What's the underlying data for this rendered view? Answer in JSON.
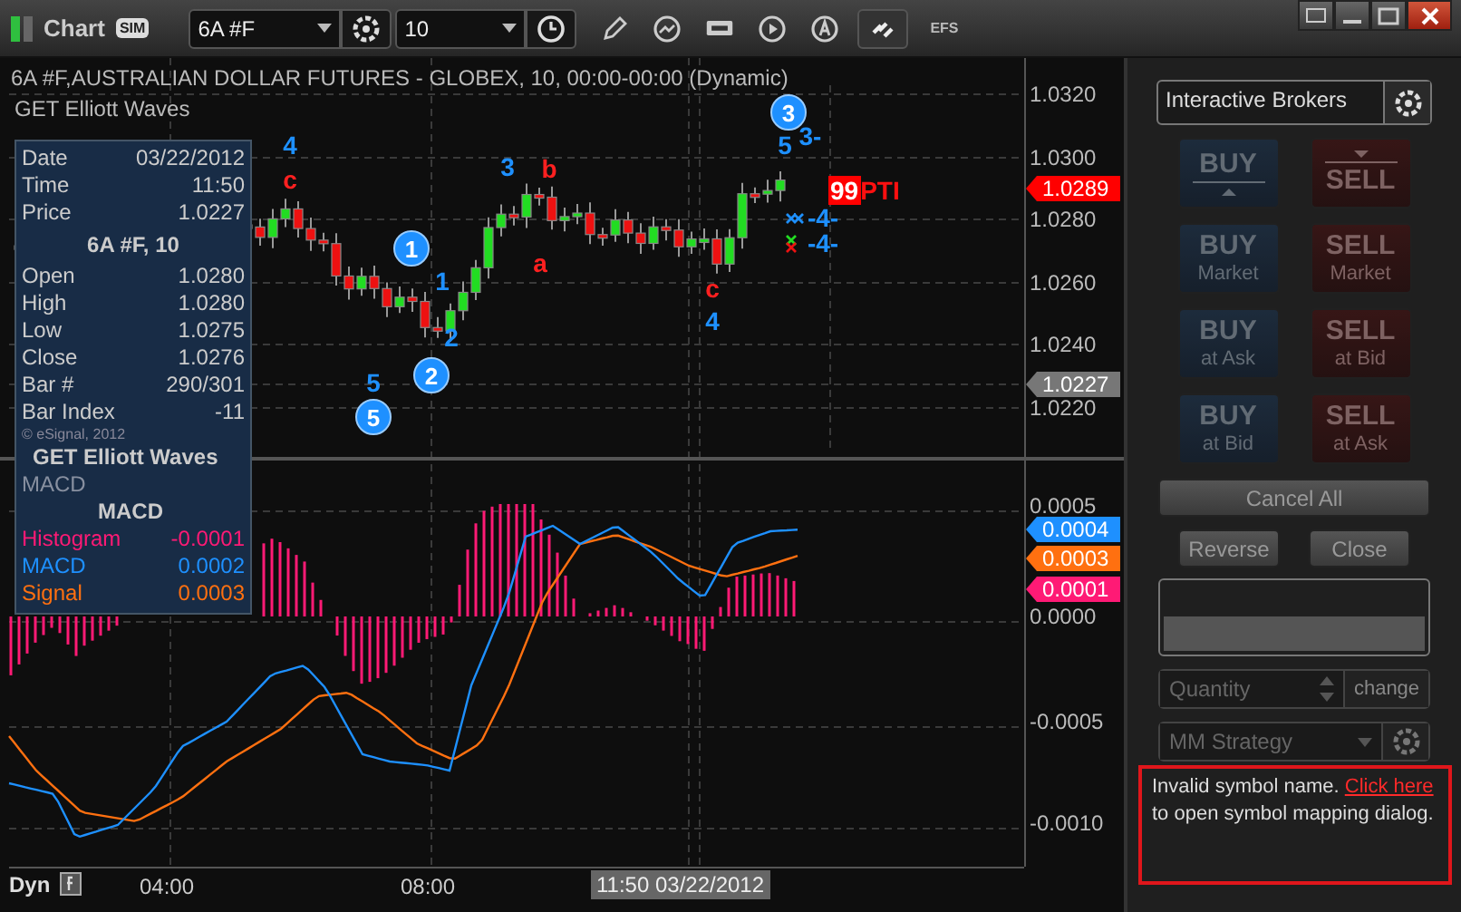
{
  "window": {
    "title": "Chart",
    "mode_badge": "SIM"
  },
  "toolbar": {
    "symbol": "6A #F",
    "interval": "10",
    "efs_label": "EFS"
  },
  "price_pane": {
    "title": "6A #F,AUSTRALIAN DOLLAR FUTURES - GLOBEX, 10, 00:00-00:00 (Dynamic)",
    "study": "GET Elliott Waves",
    "axis_labels": [
      "1.0320",
      "1.0300",
      "1.0280",
      "1.0260",
      "1.0240",
      "1.0220"
    ],
    "price_tags": [
      {
        "text": "1.0289",
        "color": "#ff0000"
      },
      {
        "text": "1.0227",
        "color": "#777777"
      }
    ],
    "wave_labels": [
      {
        "text": "4",
        "kind": "plain",
        "color": "#1e90ff"
      },
      {
        "text": "c",
        "kind": "plain",
        "color": "#ff2020"
      },
      {
        "text": "1",
        "kind": "circled",
        "color": "#1e90ff"
      },
      {
        "text": "1",
        "kind": "plain",
        "color": "#1e90ff"
      },
      {
        "text": "2",
        "kind": "plain",
        "color": "#1e90ff"
      },
      {
        "text": "3",
        "kind": "plain",
        "color": "#1e90ff"
      },
      {
        "text": "b",
        "kind": "plain",
        "color": "#ff2020"
      },
      {
        "text": "a",
        "kind": "plain",
        "color": "#ff2020"
      },
      {
        "text": "5",
        "kind": "plain",
        "color": "#1e90ff"
      },
      {
        "text": "2",
        "kind": "circled",
        "color": "#1e90ff"
      },
      {
        "text": "5",
        "kind": "circled",
        "color": "#1e90ff"
      },
      {
        "text": "c",
        "kind": "plain",
        "color": "#ff2020"
      },
      {
        "text": "4",
        "kind": "plain",
        "color": "#1e90ff"
      },
      {
        "text": "3",
        "kind": "circled",
        "color": "#1e90ff"
      },
      {
        "text": "5",
        "kind": "plain",
        "color": "#1e90ff"
      },
      {
        "text": "3-",
        "kind": "plain",
        "color": "#1e90ff"
      },
      {
        "text": "-4-",
        "kind": "plain",
        "color": "#1e90ff"
      },
      {
        "text": "-4-",
        "kind": "plain",
        "color": "#1e90ff"
      }
    ],
    "pti": {
      "value": "99",
      "label": "PTI"
    }
  },
  "data_window": {
    "rows": [
      {
        "label": "Date",
        "value": "03/22/2012"
      },
      {
        "label": "Time",
        "value": "11:50"
      },
      {
        "label": "Price",
        "value": "1.0227"
      }
    ],
    "symbol_heading": "6A #F, 10",
    "bar_rows": [
      {
        "label": "Open",
        "value": "1.0280"
      },
      {
        "label": "High",
        "value": "1.0280"
      },
      {
        "label": "Low",
        "value": "1.0275"
      },
      {
        "label": "Close",
        "value": "1.0276"
      },
      {
        "label": "Bar #",
        "value": "290/301"
      },
      {
        "label": "Bar Index",
        "value": "-11"
      }
    ],
    "copyright": "© eSignal, 2012",
    "study_heading": "GET Elliott Waves",
    "macd_caption": "MACD",
    "macd_heading": "MACD",
    "macd_rows": [
      {
        "label": "Histogram",
        "value": "-0.0001",
        "color": "#ff1a75"
      },
      {
        "label": "MACD",
        "value": "0.0002",
        "color": "#1e90ff"
      },
      {
        "label": "Signal",
        "value": "0.0003",
        "color": "#ff7010"
      }
    ]
  },
  "macd_pane": {
    "axis_labels": [
      "0.0005",
      "0.0000",
      "-0.0005",
      "-0.0010"
    ],
    "value_tags": [
      {
        "text": "0.0004",
        "color": "#1e90ff"
      },
      {
        "text": "0.0003",
        "color": "#ff7010"
      },
      {
        "text": "0.0001",
        "color": "#ff1a75"
      }
    ]
  },
  "time_axis": {
    "mode": "Dyn",
    "labels": [
      "04:00",
      "08:00"
    ],
    "cursor": "11:50 03/22/2012"
  },
  "trade_panel": {
    "broker": "Interactive Brokers",
    "order_buttons": [
      {
        "kind": "buy",
        "label": "BUY",
        "disabled": true
      },
      {
        "kind": "sell",
        "label": "SELL",
        "disabled": true
      },
      {
        "kind": "buy",
        "label": "BUY",
        "sub": "Market",
        "disabled": true
      },
      {
        "kind": "sell",
        "label": "SELL",
        "sub": "Market",
        "disabled": true
      },
      {
        "kind": "buy",
        "label": "BUY",
        "sub": "at Ask",
        "disabled": true
      },
      {
        "kind": "sell",
        "label": "SELL",
        "sub": "at Bid",
        "disabled": true
      },
      {
        "kind": "buy",
        "label": "BUY",
        "sub": "at Bid",
        "disabled": true
      },
      {
        "kind": "sell",
        "label": "SELL",
        "sub": "at Ask",
        "disabled": true
      }
    ],
    "cancel_all": {
      "label": "Cancel All",
      "disabled": true
    },
    "reverse": {
      "label": "Reverse",
      "disabled": true
    },
    "close": {
      "label": "Close",
      "disabled": true
    },
    "quantity_placeholder": "Quantity",
    "change": "change",
    "strategy_placeholder": "MM Strategy",
    "message": {
      "before": "Invalid symbol name. ",
      "link": "Click here",
      "after": " to open symbol mapping dialog."
    }
  }
}
